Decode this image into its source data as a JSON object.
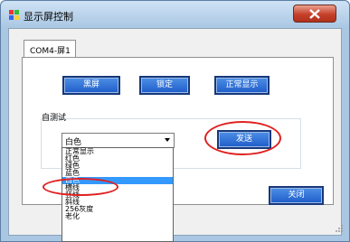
{
  "window": {
    "title": "显示屏控制"
  },
  "tab": {
    "label": "COM4-屏1"
  },
  "buttons": {
    "black_screen": "黑屏",
    "lock": "锁定",
    "normal_display": "正常显示",
    "send": "发送",
    "close": "关闭"
  },
  "self_test": {
    "label": "自测试",
    "selected_value": "白色",
    "options": [
      "正常显示",
      "红色",
      "绿色",
      "蓝色",
      "白色",
      "横线",
      "竖线",
      "斜线",
      "256灰度",
      "老化"
    ],
    "highlighted_index": 4
  },
  "colors": {
    "title_bar": "#a9c7e3",
    "button_blue": "#1f5cc9",
    "close_red": "#c6402a",
    "selection": "#3399ff",
    "annotation": "#e02020"
  }
}
